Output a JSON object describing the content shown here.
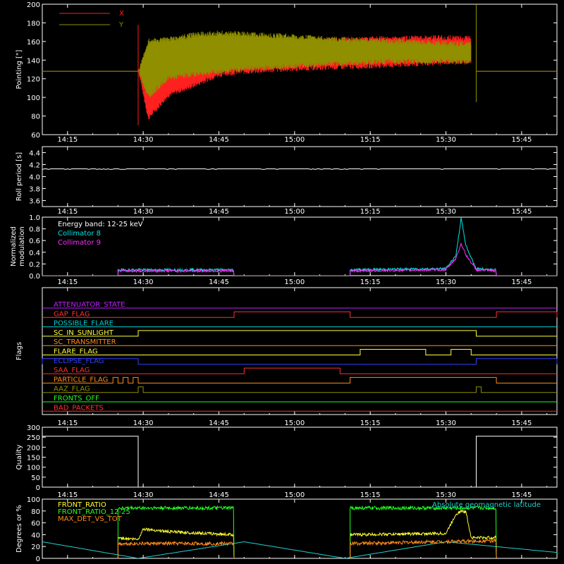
{
  "colors": {
    "background": "#000000",
    "axes": "#ffffff",
    "x_pointing": "#ff2020",
    "y_pointing": "#8f8f00",
    "roll": "#ffffff",
    "collimator8": "#00e5e5",
    "collimator9": "#ff30ff",
    "quality": "#ffffff",
    "front_ratio": "#ffff30",
    "front_ratio_1225": "#20ff20",
    "max_det_vs_tot": "#ff8c1a",
    "geomag": "#20d0d0"
  },
  "time_axis": {
    "range": [
      "14:10",
      "15:52"
    ],
    "ticks": [
      "14:15",
      "14:30",
      "14:45",
      "15:00",
      "15:15",
      "15:30",
      "15:45"
    ]
  },
  "chart_data": [
    {
      "type": "line",
      "ylabel": "Pointing [\"]",
      "ylim": [
        60,
        200
      ],
      "yticks": [
        "60",
        "80",
        "100",
        "120",
        "140",
        "160",
        "180",
        "200"
      ],
      "legend_placement": "top-left",
      "series": [
        {
          "name": "X",
          "color_key": "x_pointing",
          "x": [
            "14:10",
            "14:29",
            "14:31",
            "14:35",
            "14:40",
            "14:45",
            "14:50",
            "15:00",
            "15:10",
            "15:20",
            "15:30",
            "15:35",
            "15:36"
          ],
          "low": [
            128,
            128,
            75,
            100,
            110,
            122,
            125,
            128,
            130,
            132,
            135,
            135,
            128
          ],
          "high": [
            128,
            128,
            158,
            160,
            162,
            162,
            162,
            163,
            165,
            166,
            167,
            166,
            128
          ]
        },
        {
          "name": "Y",
          "color_key": "y_pointing",
          "x": [
            "14:10",
            "14:29",
            "14:31",
            "14:35",
            "14:40",
            "14:45",
            "14:50",
            "15:00",
            "15:10",
            "15:20",
            "15:30",
            "15:35",
            "15:36"
          ],
          "low": [
            128,
            128,
            98,
            118,
            122,
            125,
            128,
            131,
            134,
            136,
            136,
            136,
            128
          ],
          "high": [
            128,
            128,
            163,
            165,
            170,
            172,
            171,
            168,
            165,
            163,
            161,
            160,
            128
          ]
        }
      ]
    },
    {
      "type": "line",
      "ylabel": "Roll period [s]",
      "ylim": [
        3.5,
        4.5
      ],
      "yticks": [
        "3.6",
        "3.8",
        "4.0",
        "4.2",
        "4.4"
      ],
      "series": [
        {
          "color_key": "roll",
          "x": [
            "14:10",
            "15:52"
          ],
          "y": [
            4.13,
            4.13
          ]
        }
      ]
    },
    {
      "type": "line",
      "ylabel": "Normalized modulation",
      "ylim": [
        0,
        1
      ],
      "yticks": [
        "0.0",
        "0.2",
        "0.4",
        "0.6",
        "0.8",
        "1.0"
      ],
      "legend_placement": "top-left",
      "annotations": [
        "Energy band: 12-25 keV"
      ],
      "series": [
        {
          "name": "Collimator 8",
          "color_key": "collimator8",
          "x": [
            "14:25",
            "14:48",
            "15:11",
            "15:30",
            "15:32",
            "15:33",
            "15:34",
            "15:36",
            "15:40"
          ],
          "y": [
            0.1,
            0.1,
            0.1,
            0.12,
            0.35,
            0.98,
            0.5,
            0.12,
            0.1
          ]
        },
        {
          "name": "Collimator 9",
          "color_key": "collimator9",
          "x": [
            "14:25",
            "14:48",
            "15:11",
            "15:30",
            "15:32",
            "15:33",
            "15:34",
            "15:36",
            "15:40"
          ],
          "y": [
            0.08,
            0.08,
            0.08,
            0.1,
            0.3,
            0.55,
            0.35,
            0.1,
            0.08
          ]
        }
      ]
    },
    {
      "type": "line",
      "ylabel": "Flags",
      "flags": [
        {
          "name": "ATTENUATOR_STATE",
          "color": "#c020ff",
          "steps": []
        },
        {
          "name": "GAP_FLAG",
          "color": "#ff3030",
          "steps": [
            [
              "14:48",
              "15:11"
            ],
            [
              "15:40",
              "15:52"
            ]
          ]
        },
        {
          "name": "POSSIBLE_FLARE",
          "color": "#00d0d0",
          "steps": []
        },
        {
          "name": "SC_IN_SUNLIGHT",
          "color": "#ffff40",
          "steps": [
            [
              "14:29",
              "15:36"
            ]
          ]
        },
        {
          "name": "SC_TRANSMITTER",
          "color": "#ff8c1a",
          "steps": []
        },
        {
          "name": "FLARE_FLAG",
          "color": "#ffff40",
          "steps": [
            [
              "15:13",
              "15:26"
            ],
            [
              "15:31",
              "15:35"
            ]
          ]
        },
        {
          "name": "ECLIPSE_FLAG",
          "color": "#3040ff",
          "steps": [
            [
              "14:10",
              "14:29"
            ],
            [
              "15:36",
              "15:52"
            ]
          ]
        },
        {
          "name": "SAA_FLAG",
          "color": "#ff3030",
          "steps": [
            [
              "14:50",
              "15:09"
            ]
          ]
        },
        {
          "name": "PARTICLE_FLAG",
          "color": "#ff8c1a",
          "steps": [
            [
              "14:24",
              "14:25"
            ],
            [
              "14:26",
              "14:27"
            ],
            [
              "14:28",
              "14:29"
            ],
            [
              "15:11",
              "15:40"
            ]
          ]
        },
        {
          "name": "AAZ_FLAG",
          "color": "#909000",
          "steps": [
            [
              "14:29",
              "14:30"
            ],
            [
              "15:36",
              "15:37"
            ]
          ]
        },
        {
          "name": "FRONTS_OFF",
          "color": "#20ff20",
          "steps": []
        },
        {
          "name": "BAD_PACKETS",
          "color": "#ff3030",
          "steps": []
        }
      ]
    },
    {
      "type": "line",
      "ylabel": "Quality",
      "ylim": [
        0,
        300
      ],
      "yticks": [
        "0",
        "50",
        "100",
        "150",
        "200",
        "250",
        "300"
      ],
      "series": [
        {
          "color_key": "quality",
          "x": [
            "14:10",
            "14:29",
            "14:29",
            "15:36",
            "15:36",
            "15:52"
          ],
          "y": [
            255,
            255,
            0,
            0,
            255,
            255
          ]
        }
      ]
    },
    {
      "type": "line",
      "ylabel": "Degrees or %",
      "ylim": [
        0,
        100
      ],
      "yticks": [
        "0",
        "20",
        "40",
        "60",
        "80",
        "100"
      ],
      "legend_placement": "top-left",
      "series": [
        {
          "name": "FRONT_RATIO",
          "color_key": "front_ratio",
          "x": [
            "14:25",
            "14:29",
            "14:30",
            "14:35",
            "14:48",
            "15:11",
            "15:30",
            "15:32",
            "15:33",
            "15:34",
            "15:35",
            "15:40"
          ],
          "y": [
            35,
            32,
            50,
            45,
            40,
            40,
            42,
            75,
            80,
            78,
            35,
            35
          ]
        },
        {
          "name": "FRONT_RATIO_12-25",
          "color_key": "front_ratio_1225",
          "x": [
            "14:25",
            "14:48",
            "15:11",
            "15:40"
          ],
          "y": [
            85,
            85,
            85,
            85
          ]
        },
        {
          "name": "MAX_DET_VS_TOT",
          "color_key": "max_det_vs_tot",
          "x": [
            "14:25",
            "14:48",
            "15:11",
            "15:40"
          ],
          "y": [
            25,
            25,
            25,
            30
          ]
        },
        {
          "name": "Absolute geomagnetic latitude",
          "color_key": "geomag",
          "x": [
            "14:10",
            "14:29",
            "14:50",
            "15:10",
            "15:30",
            "15:52"
          ],
          "y": [
            28,
            0,
            28,
            0,
            28,
            10
          ]
        }
      ]
    }
  ]
}
